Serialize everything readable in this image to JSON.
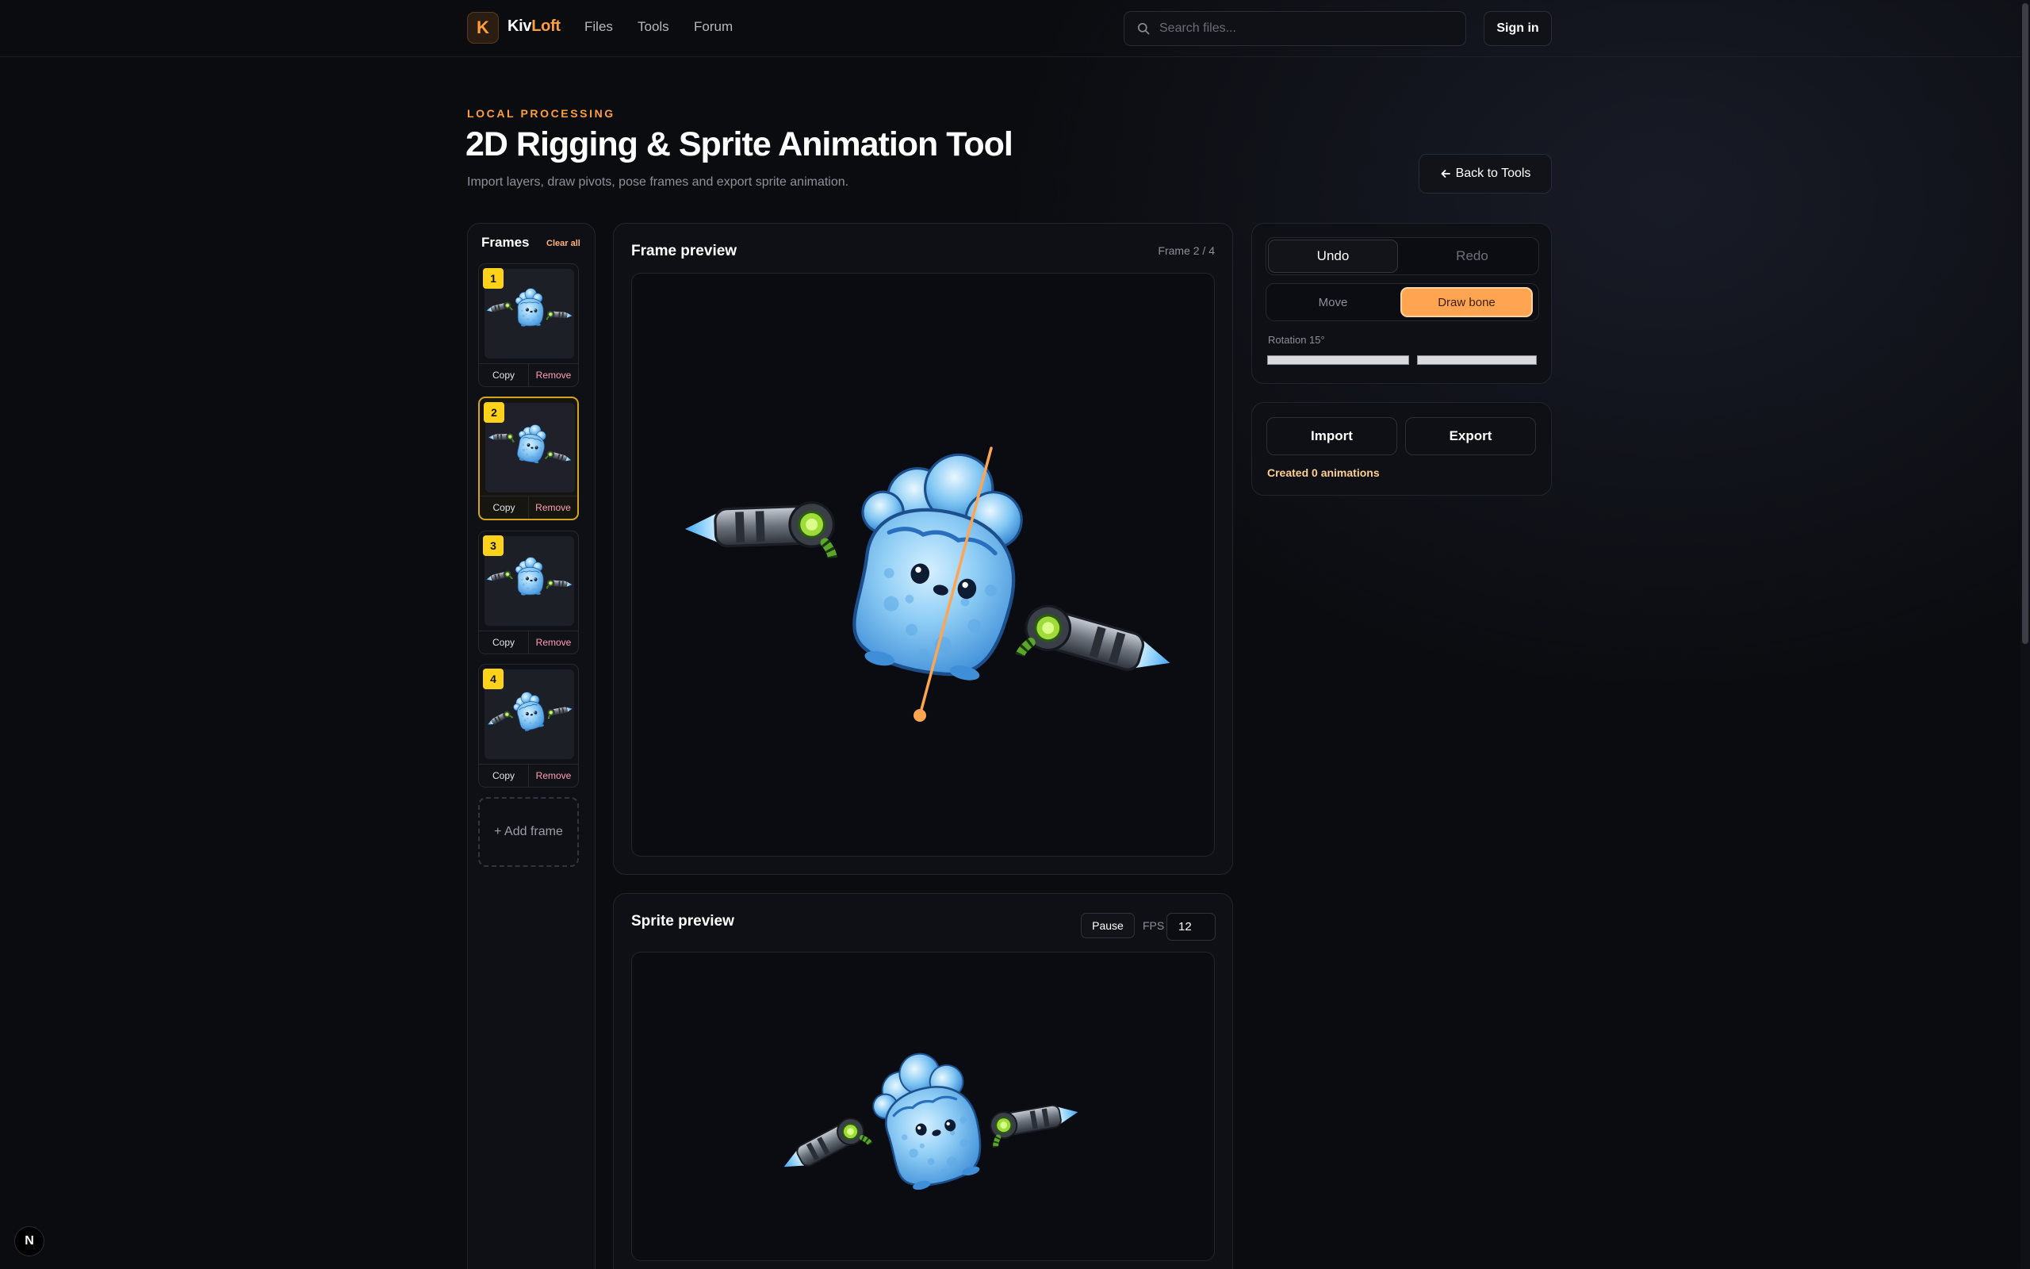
{
  "nav": {
    "logo_letter": "K",
    "brand_part1": "Kiv",
    "brand_part2": "Loft",
    "links": [
      "Files",
      "Tools",
      "Forum"
    ],
    "search_placeholder": "Search files...",
    "signin_label": "Sign in"
  },
  "header": {
    "eyebrow": "LOCAL PROCESSING",
    "title": "2D Rigging & Sprite Animation Tool",
    "subtitle": "Import layers, draw pivots, pose frames and export sprite animation.",
    "back_label": "Back to Tools"
  },
  "frames": {
    "title": "Frames",
    "clear_all": "Clear all",
    "items": [
      {
        "number": "1",
        "copy": "Copy",
        "remove": "Remove",
        "selected": false
      },
      {
        "number": "2",
        "copy": "Copy",
        "remove": "Remove",
        "selected": true
      },
      {
        "number": "3",
        "copy": "Copy",
        "remove": "Remove",
        "selected": false
      },
      {
        "number": "4",
        "copy": "Copy",
        "remove": "Remove",
        "selected": false
      }
    ],
    "add_frame": "+ Add frame"
  },
  "frame_preview": {
    "title": "Frame preview",
    "counter": "Frame 2 / 4",
    "bone_color": "#ffa552"
  },
  "sprite_preview": {
    "title": "Sprite preview",
    "pause_label": "Pause",
    "fps_label": "FPS",
    "fps_value": "12"
  },
  "tools": {
    "undo": "Undo",
    "redo": "Redo",
    "move": "Move",
    "draw_bone": "Draw bone",
    "active_mode": "Draw bone",
    "rotation_label": "Rotation 15°",
    "accent": "#ffa552"
  },
  "io": {
    "import": "Import",
    "export": "Export",
    "status": "Created 0 animations"
  },
  "badge": {
    "letter": "N"
  },
  "colors": {
    "background": "#0b0c10",
    "accent_orange": "#ff9e3d",
    "frame_badge": "#ffd21a",
    "remove_text": "#ff9fb4"
  }
}
